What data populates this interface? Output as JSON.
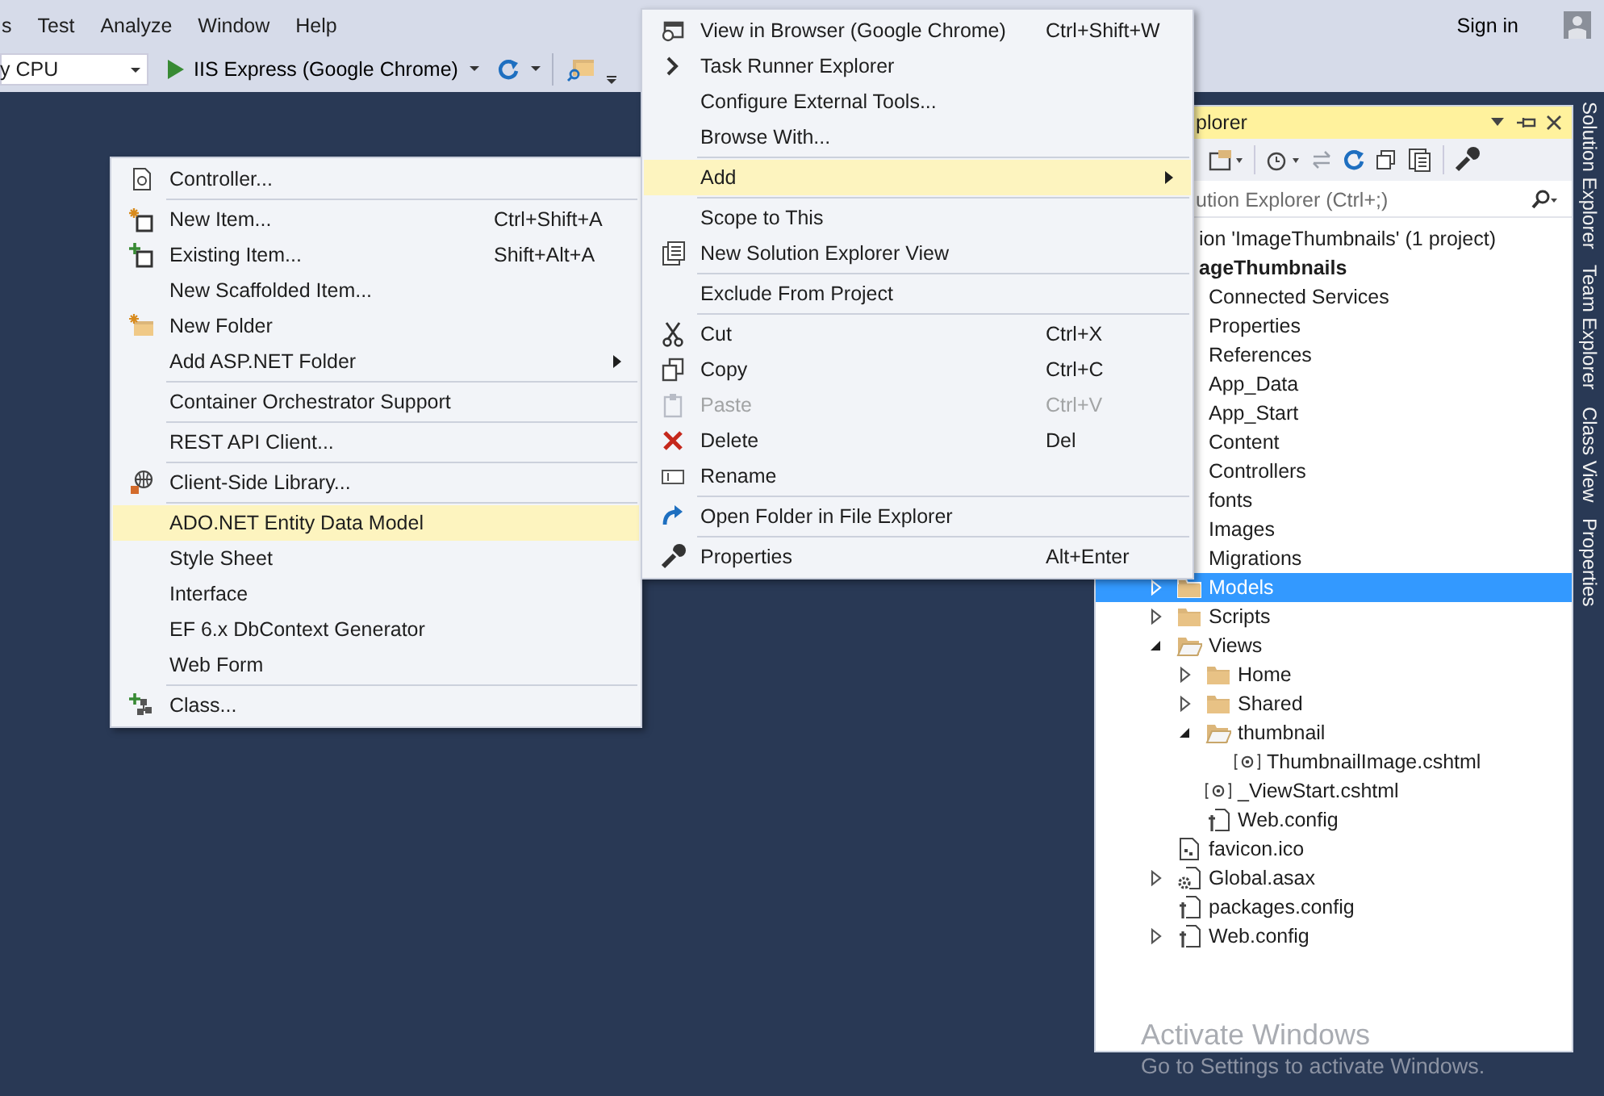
{
  "menubar": {
    "items": [
      "s",
      "Test",
      "Analyze",
      "Window",
      "Help"
    ],
    "account": "Sign in"
  },
  "toolbar": {
    "platform": "y CPU",
    "run_target": "IIS Express (Google Chrome)"
  },
  "context_menus": [
    {
      "groups": [
        [
          {
            "label": "View in Browser (Google Chrome)",
            "shortcut": "Ctrl+Shift+W",
            "selected": false,
            "disabled": false
          },
          {
            "label": "Task Runner Explorer",
            "selected": false,
            "disabled": false
          },
          {
            "label": "Configure External Tools...",
            "selected": false,
            "disabled": false
          },
          {
            "label": "Browse With...",
            "selected": false,
            "disabled": false
          }
        ],
        [
          {
            "label": "Add",
            "submenu": true,
            "selected": true,
            "disabled": false
          }
        ],
        [
          {
            "label": "Scope to This",
            "selected": false,
            "disabled": false
          },
          {
            "label": "New Solution Explorer View",
            "selected": false,
            "disabled": false
          }
        ],
        [
          {
            "label": "Exclude From Project",
            "selected": false,
            "disabled": false
          }
        ],
        [
          {
            "label": "Cut",
            "shortcut": "Ctrl+X",
            "selected": false,
            "disabled": false
          },
          {
            "label": "Copy",
            "shortcut": "Ctrl+C",
            "selected": false,
            "disabled": false
          },
          {
            "label": "Paste",
            "shortcut": "Ctrl+V",
            "selected": false,
            "disabled": true
          },
          {
            "label": "Delete",
            "shortcut": "Del",
            "selected": false,
            "disabled": false
          },
          {
            "label": "Rename",
            "selected": false,
            "disabled": false
          }
        ],
        [
          {
            "label": "Open Folder in File Explorer",
            "selected": false,
            "disabled": false
          }
        ],
        [
          {
            "label": "Properties",
            "shortcut": "Alt+Enter",
            "selected": false,
            "disabled": false
          }
        ]
      ]
    },
    {
      "groups": [
        [
          {
            "label": "Controller...",
            "selected": false,
            "disabled": false
          }
        ],
        [
          {
            "label": "New Item...",
            "shortcut": "Ctrl+Shift+A",
            "selected": false,
            "disabled": false
          },
          {
            "label": "Existing Item...",
            "shortcut": "Shift+Alt+A",
            "selected": false,
            "disabled": false
          },
          {
            "label": "New Scaffolded Item...",
            "selected": false,
            "disabled": false
          },
          {
            "label": "New Folder",
            "selected": false,
            "disabled": false
          },
          {
            "label": "Add ASP.NET Folder",
            "submenu": true,
            "selected": false,
            "disabled": false
          }
        ],
        [
          {
            "label": "Container Orchestrator Support",
            "selected": false,
            "disabled": false
          }
        ],
        [
          {
            "label": "REST API Client...",
            "selected": false,
            "disabled": false
          }
        ],
        [
          {
            "label": "Client-Side Library...",
            "selected": false,
            "disabled": false
          }
        ],
        [
          {
            "label": "ADO.NET Entity Data Model",
            "selected": true,
            "disabled": false
          },
          {
            "label": "Style Sheet",
            "selected": false,
            "disabled": false
          },
          {
            "label": "Interface",
            "selected": false,
            "disabled": false
          },
          {
            "label": "EF 6.x DbContext Generator",
            "selected": false,
            "disabled": false
          },
          {
            "label": "Web Form",
            "selected": false,
            "disabled": false
          }
        ],
        [
          {
            "label": "Class...",
            "selected": false,
            "disabled": false
          }
        ]
      ]
    }
  ],
  "solution_explorer": {
    "title": "plorer",
    "search": {
      "placeholder": "ution Explorer (Ctrl+;)"
    },
    "solution": "ion 'ImageThumbnails' (1 project)",
    "project": "ageThumbnails",
    "items": [
      {
        "label": "Connected Services",
        "selected": false
      },
      {
        "label": "Properties",
        "selected": false
      },
      {
        "label": "References",
        "selected": false
      },
      {
        "label": "App_Data",
        "selected": false
      },
      {
        "label": "App_Start",
        "selected": false
      },
      {
        "label": "Content",
        "selected": false
      },
      {
        "label": "Controllers",
        "selected": false
      },
      {
        "label": "fonts",
        "selected": false
      },
      {
        "label": "Images",
        "selected": false
      },
      {
        "label": "Migrations",
        "selected": false
      },
      {
        "label": "Models",
        "kind": "folder",
        "expanded": false,
        "selected": true
      },
      {
        "label": "Scripts",
        "kind": "folder",
        "expanded": false,
        "selected": false
      },
      {
        "label": "Views",
        "kind": "folder",
        "expanded": true,
        "selected": false,
        "children": [
          {
            "label": "Home",
            "kind": "folder",
            "expanded": false,
            "selected": false
          },
          {
            "label": "Shared",
            "kind": "folder",
            "expanded": false,
            "selected": false
          },
          {
            "label": "thumbnail",
            "kind": "folder",
            "expanded": true,
            "selected": false,
            "children": [
              {
                "label": "ThumbnailImage.cshtml",
                "kind": "razor",
                "selected": false
              }
            ]
          },
          {
            "label": "_ViewStart.cshtml",
            "kind": "razor",
            "selected": false
          },
          {
            "label": "Web.config",
            "kind": "config",
            "selected": false
          }
        ]
      },
      {
        "label": "favicon.ico",
        "kind": "image-file",
        "selected": false
      },
      {
        "label": "Global.asax",
        "kind": "asax",
        "expanded": false,
        "selected": false
      },
      {
        "label": "packages.config",
        "kind": "config",
        "selected": false
      },
      {
        "label": "Web.config",
        "kind": "config",
        "expanded": false,
        "selected": false
      }
    ]
  },
  "side_tabs": [
    "Solution Explorer",
    "Team Explorer",
    "Class View",
    "Properties"
  ],
  "activation_notice": {
    "title": "Activate Windows",
    "text": "Go to Settings to activate Windows."
  }
}
